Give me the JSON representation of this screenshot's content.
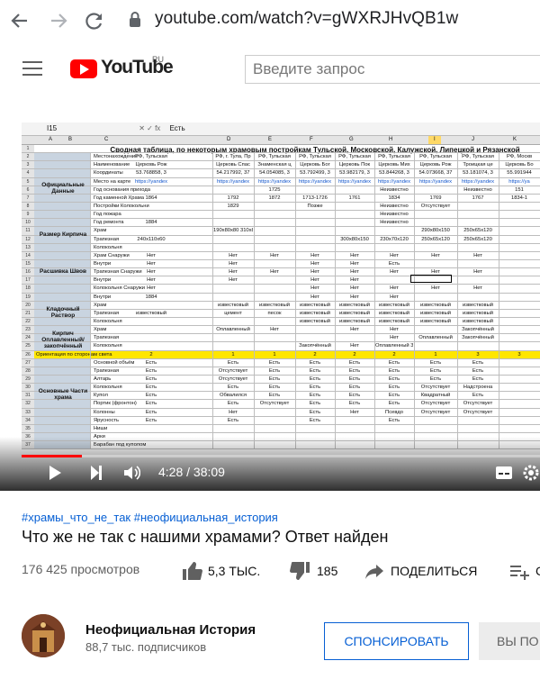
{
  "browser": {
    "url": "youtube.com/watch?v=gWXRJHvQB1w",
    "back_icon": "back-arrow-icon",
    "forward_icon": "forward-arrow-icon",
    "reload_icon": "reload-icon",
    "lock_icon": "lock-icon"
  },
  "header": {
    "logo_text": "YouTube",
    "logo_region": "RU",
    "search_placeholder": "Введите запрос",
    "menu_icon": "hamburger-menu-icon"
  },
  "video": {
    "sheet": {
      "cell_ref": "I15",
      "formula_text": "Есть",
      "title": "Сводная таблица, по некоторым храмовым постройкам Тульской, Московской, Калужской, Липецкой и Рязанской",
      "columns": [
        "A",
        "B",
        "C",
        "D",
        "E",
        "F",
        "G",
        "H",
        "I",
        "J",
        "K",
        "L"
      ],
      "groups": [
        {
          "label": "Официальные Данные",
          "row_start": 2,
          "row_end": 10
        },
        {
          "label": "Размер Кирпича",
          "row_start": 11,
          "row_end": 13
        },
        {
          "label": "Расшивка Швов",
          "row_start": 14,
          "row_end": 19
        },
        {
          "label": "Кладочный Раствор",
          "row_start": 20,
          "row_end": 22
        },
        {
          "label": "Кирпич Оплавленный/ закопчённый",
          "row_start": 23,
          "row_end": 25
        },
        {
          "label": "Основные Части храма",
          "row_start": 27,
          "row_end": 35
        }
      ],
      "rows": [
        {
          "n": "2",
          "label": "Местонахождение",
          "cells": [
            "РФ, Тульская",
            "РФ, г. Тула, Пр",
            "РФ, Тульская",
            "РФ, Тульская",
            "РФ, Тульская",
            "РФ, Тульская",
            "РФ, Тульская",
            "РФ, Тульская",
            "РФ, Москв"
          ]
        },
        {
          "n": "3",
          "label": "Наименование",
          "cells": [
            "Церковь Рож",
            "Церковь Спас",
            "Знаменская ц",
            "Церковь Бог",
            "Церковь Пок",
            "Церковь Мих",
            "Церковь Рож",
            "Троицкая це",
            "Церковь Бо"
          ]
        },
        {
          "n": "4",
          "label": "Координаты",
          "cells": [
            "53.768858, 3",
            "54.217992, 37",
            "54.054085, 3",
            "53.792499, 3",
            "53.982179, 3",
            "53.844268, 3",
            "54.073668, 37",
            "53.181074, 3",
            "55.991944"
          ]
        },
        {
          "n": "5",
          "label": "Место на карте",
          "cells": [
            "https://yandex",
            "https://yandex",
            "https://yandex",
            "https://yandex",
            "https://yandex",
            "https://yandex",
            "https://yandex",
            "https://yandex",
            "https://ya"
          ]
        },
        {
          "n": "6",
          "label": "Год основания прихода",
          "cells": [
            "",
            "",
            "1725",
            "",
            "",
            "Неизвестно",
            "",
            "Неизвестно",
            "151"
          ]
        },
        {
          "n": "7",
          "label": "Год каменной  Храма",
          "cells": [
            "1864",
            "1792",
            "1872",
            "1713-1726",
            "1761",
            "1834",
            "1769",
            "1767",
            "1834-1"
          ]
        },
        {
          "n": "8",
          "label": "Постройки  Колокольни",
          "cells": [
            "",
            "1829",
            "",
            "Позже",
            "",
            "Неизвестно",
            "Отсутствует",
            "",
            ""
          ]
        },
        {
          "n": "9",
          "label": "Год пожара",
          "cells": [
            "",
            "",
            "",
            "",
            "",
            "Неизвестно",
            "",
            "",
            ""
          ]
        },
        {
          "n": "10",
          "label": "Год ремонта",
          "cells": [
            "1884",
            "",
            "",
            "",
            "",
            "Неизвестно",
            "",
            "",
            ""
          ]
        },
        {
          "n": "11",
          "label": "Храм",
          "cells": [
            "",
            "190x80x80 310x80x150",
            "",
            "",
            "",
            "",
            "290x80x150",
            "250x65x120",
            ""
          ]
        },
        {
          "n": "12",
          "label": "Трапезная",
          "cells": [
            "240x110x60",
            "",
            "",
            "",
            "300x80x150",
            "230x70x120",
            "250x65x120",
            "250x65x120",
            ""
          ]
        },
        {
          "n": "13",
          "label": "Колокольня",
          "cells": [
            "",
            "",
            "",
            "",
            "",
            "",
            "",
            "",
            ""
          ]
        },
        {
          "n": "14",
          "label": "Храм  Снаружи",
          "cells": [
            "Нет",
            "Нет",
            "Нет",
            "Нет",
            "Нет",
            "Нет",
            "Нет",
            "Нет",
            ""
          ]
        },
        {
          "n": "15",
          "label": "Внутри",
          "cells": [
            "Нет",
            "Нет",
            "",
            "Нет",
            "Нет",
            "Есть",
            "",
            "",
            ""
          ]
        },
        {
          "n": "16",
          "label": "Трапезная  Снаружи",
          "cells": [
            "Нет",
            "Нет",
            "Нет",
            "Нет",
            "Нет",
            "Нет",
            "Нет",
            "Нет",
            ""
          ]
        },
        {
          "n": "17",
          "label": "Внутри",
          "cells": [
            "Нет",
            "Нет",
            "",
            "Нет",
            "Нет",
            "",
            "",
            "",
            ""
          ]
        },
        {
          "n": "18",
          "label": "Колокольня  Снаружи",
          "cells": [
            "Нет",
            "",
            "",
            "Нет",
            "Нет",
            "Нет",
            "Нет",
            "Нет",
            ""
          ]
        },
        {
          "n": "19",
          "label": "Внутри",
          "cells": [
            "1884",
            "",
            "",
            "Нет",
            "Нет",
            "Нет",
            "",
            "",
            ""
          ]
        },
        {
          "n": "20",
          "label": "Храм",
          "cells": [
            "",
            "известковый",
            "известковый",
            "известковый",
            "известковый",
            "известковый",
            "известковый",
            "известковый",
            ""
          ]
        },
        {
          "n": "21",
          "label": "Трапезная",
          "cells": [
            "известковый",
            "цемент",
            "песок",
            "известковый",
            "известковый",
            "известковый",
            "известковый",
            "известковый",
            ""
          ]
        },
        {
          "n": "22",
          "label": "Колокольня",
          "cells": [
            "",
            "",
            "",
            "известковый",
            "известковый",
            "известковый",
            "известковый",
            "известковый",
            ""
          ]
        },
        {
          "n": "23",
          "label": "Храм",
          "cells": [
            "",
            "Оплавленный",
            "Нет",
            "",
            "Нет",
            "Нет",
            "",
            "Закопчённый",
            ""
          ]
        },
        {
          "n": "24",
          "label": "Трапезная",
          "cells": [
            "",
            "",
            "",
            "",
            "",
            "Нет",
            "Оплавленный",
            "Закопчённый",
            ""
          ]
        },
        {
          "n": "25",
          "label": "Колокольня",
          "cells": [
            "",
            "",
            "",
            "Закопчённый",
            "Нет",
            "Оплавленный 3з",
            "",
            "",
            ""
          ]
        },
        {
          "n": "26",
          "label": "Ориентация по сторонам света",
          "cells": [
            "2",
            "1",
            "1",
            "2",
            "2",
            "2",
            "1",
            "3",
            "3"
          ]
        },
        {
          "n": "27",
          "label": "Основной объём",
          "cells": [
            "Есть",
            "Есть",
            "Есть",
            "Есть",
            "Есть",
            "Есть",
            "Есть",
            "Есть",
            ""
          ]
        },
        {
          "n": "28",
          "label": "Трапезная",
          "cells": [
            "Есть",
            "Отсутствует",
            "Есть",
            "Есть",
            "Есть",
            "Есть",
            "Есть",
            "Есть",
            ""
          ]
        },
        {
          "n": "29",
          "label": "Алтарь",
          "cells": [
            "Есть",
            "Отсутствует",
            "Есть",
            "Есть",
            "Есть",
            "Есть",
            "Есть",
            "Есть",
            ""
          ]
        },
        {
          "n": "30",
          "label": "Колокольня",
          "cells": [
            "Есть",
            "Есть",
            "Есть",
            "Есть",
            "Есть",
            "Есть",
            "Отсутствует",
            "Надстроена",
            ""
          ]
        },
        {
          "n": "31",
          "label": "Купол",
          "cells": [
            "Есть",
            "Обвалился",
            "Есть",
            "Есть",
            "Есть",
            "Есть",
            "Квадратный",
            "Есть",
            ""
          ]
        },
        {
          "n": "32",
          "label": "Портик (фронтон)",
          "cells": [
            "Есть",
            "Есть",
            "Отсутствует",
            "Есть",
            "Есть",
            "Есть",
            "Отсутствует",
            "Отсутствует",
            ""
          ]
        },
        {
          "n": "33",
          "label": "Колонны",
          "cells": [
            "Есть",
            "Нет",
            "",
            "Есть",
            "Нет",
            "Псевдо",
            "Отсутствует",
            "Отсутствует",
            ""
          ]
        },
        {
          "n": "34",
          "label": "Ярусность",
          "cells": [
            "Есть",
            "Есть",
            "",
            "Есть",
            "",
            "Есть",
            "",
            "",
            ""
          ]
        },
        {
          "n": "35",
          "label": "Ниши",
          "cells": [
            "",
            "",
            "",
            "",
            "",
            "",
            "",
            "",
            ""
          ]
        },
        {
          "n": "36",
          "label": "Арки",
          "cells": [
            "",
            "",
            "",
            "",
            "",
            "",
            "",
            "",
            ""
          ]
        },
        {
          "n": "37",
          "label": "Барабан под куполом",
          "cells": [
            "",
            "",
            "",
            "",
            "",
            "",
            "",
            "",
            ""
          ]
        }
      ],
      "extra_labels": {
        "row33_left": "...есть на окнах",
        "row36": "Окна/Арки",
        "bottom": "Строение в барабан"
      }
    },
    "controls": {
      "time": "4:28 / 38:09",
      "progress": 0.117,
      "play_icon": "play-icon",
      "next_icon": "next-icon",
      "volume_icon": "volume-icon",
      "subtitles_icon": "subtitles-icon",
      "settings_icon": "settings-gear-icon"
    }
  },
  "meta": {
    "hashtags": "#храмы_что_не_так #неофициальная_история",
    "title": "Что же не так с нашими храмами? Ответ найден",
    "views": "176 425 просмотров",
    "likes": "5,3 ТЫС.",
    "dislikes": "185",
    "share": "ПОДЕЛИТЬСЯ",
    "save_icon": "playlist-add-icon",
    "save_label": "С"
  },
  "channel": {
    "name": "Неофициальная История",
    "subscribers": "88,7 тыс. подписчиков",
    "sponsor_label": "СПОНСИРОВАТЬ",
    "subscribe_label": "ВЫ ПО"
  },
  "colors": {
    "youtube_red": "#ff0000",
    "link_blue": "#065fd4",
    "highlight_yellow": "#ffe600"
  }
}
